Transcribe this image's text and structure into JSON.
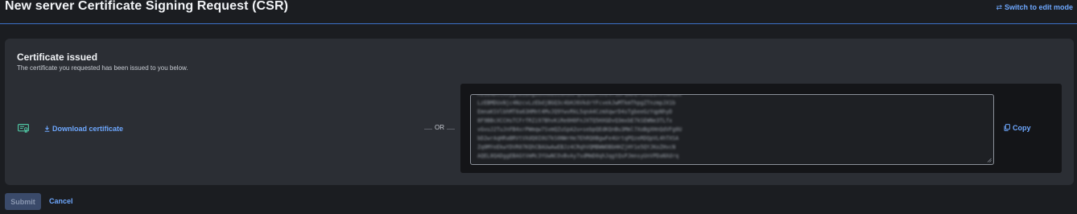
{
  "header": {
    "title": "New server Certificate Signing Request (CSR)",
    "switch_mode_label": "Switch to edit mode",
    "accent_color": "#3b71c8"
  },
  "card": {
    "title": "Certificate issued",
    "subtitle": "The certificate you requested has been issued to you below.",
    "download_label": "Download certificate",
    "or_label": "OR",
    "copy_label": "Copy",
    "icons": {
      "certificate": "certificate-icon",
      "download": "download-icon",
      "copy": "copy-icon",
      "switch": "switch-arrows-icon"
    }
  },
  "csr": {
    "lines": [
      "MIIENDCCAxygAwIBAgIUXXmdsz8H3kPqLwN0mYcRz4T1bFQwDQYJKoZIhvcNAQEL",
      "LzEBMDUxNjc4NzcvLzEbdjBGQ3c4bHJ6VkdrYFcvekJwMTkmThpgZTnzmpJX1b",
      "EmnaKSVlbhMT0a63HMnt4MvJQ9YwvRkL5qnA4CzmXqwrD4sTgbeeGzYqpNhyD",
      "8F9BBcXCCHsTCFrfRZi97BhvKiRe0H0FnJXTQ5HXGDvQ3mxbE7kSEWNe3TLfx",
      "vGvuJ2TuJnFB4xrPWmqw7SvmQZuSpA2u+sebpQEdKQnBu3Mml7XoBgXHnQdVFg0U",
      "bD2wrAqHRaBRVtVXdQ0I0U7kS0NWrHe7EhRQ0BgwFe4UrtqPQzeRDQpVL4hTXSA",
      "Zq0MYeEkwYDVR07KQhCBAUwAwEBJz4CRqhVQMBWWOBbHHZjHY1e5QYJKoZHvcN",
      "AQEL8QADggEBAGtVmMc3YUwNCOvBvAy7sdMmD0qhJqgtQsPJmnsyUnVPDaNXdrq"
    ]
  },
  "actions": {
    "submit_label": "Submit",
    "cancel_label": "Cancel"
  }
}
